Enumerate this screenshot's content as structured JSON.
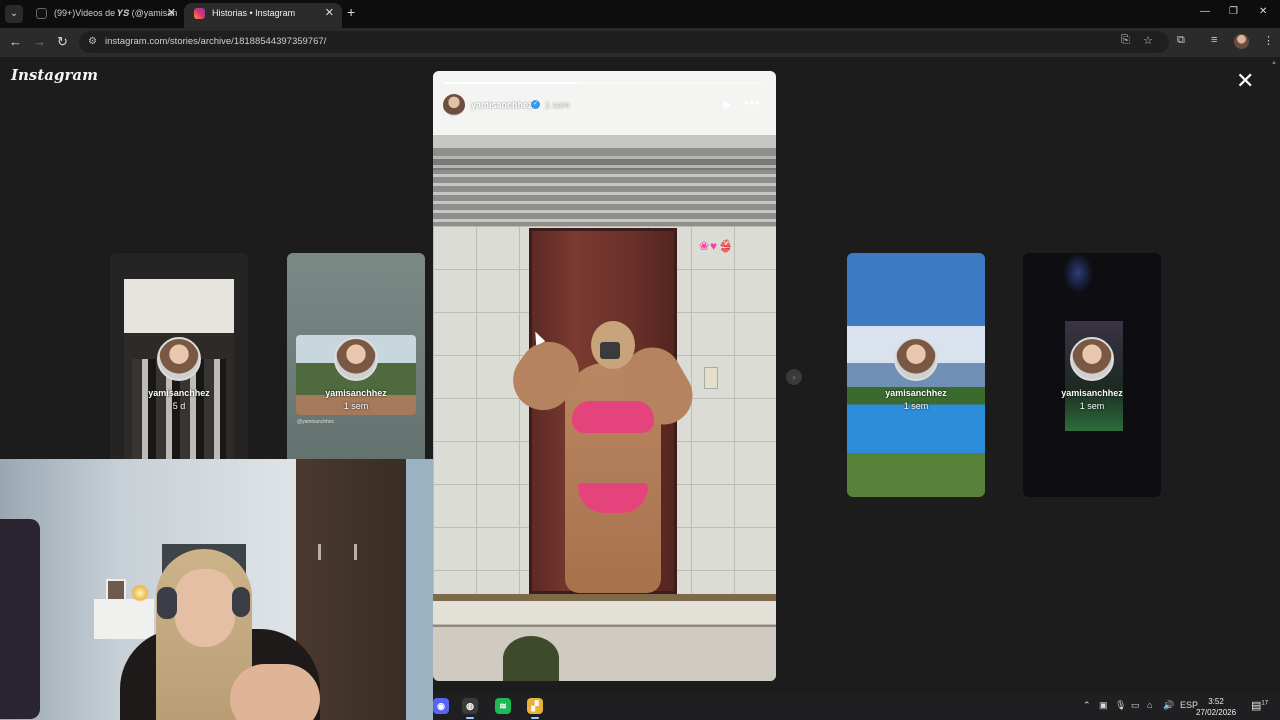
{
  "browser": {
    "tabs": [
      {
        "title": "(99+)Videos de 𝒀𝑺 (@yamisan",
        "close": "✕"
      },
      {
        "title": "Historias • Instagram",
        "close": "✕"
      }
    ],
    "new_tab": "+",
    "tab_search": "⌄",
    "window_controls": {
      "minimize": "—",
      "restore": "❐",
      "close": "✕"
    },
    "nav": {
      "back": "←",
      "forward": "→",
      "reload": "↻"
    },
    "url": "instagram.com/stories/archive/18188544397359767/",
    "icons": [
      "install-app-icon",
      "bookmark-star-icon",
      "extensions-icon",
      "media-controls-icon",
      "profile-avatar",
      "menu-kebab-icon"
    ]
  },
  "instagram": {
    "logo": "Instagram",
    "close": "✕",
    "main_story": {
      "username": "yamisanchhez",
      "verified": "✓",
      "time_ago": "1 sem",
      "progress": 0.42,
      "play": "▶",
      "more": "•••",
      "stickers": "❀♥👙"
    },
    "side_stories": [
      {
        "username": "yamisanchhez",
        "time_ago": "5 d"
      },
      {
        "username": "yamisanchhez",
        "time_ago": "1 sem",
        "caption": "@yamisanchhez"
      },
      {
        "username": "yamisanchhez",
        "time_ago": "1 sem"
      },
      {
        "username": "yamisanchhez",
        "time_ago": "1 sem"
      }
    ],
    "next_arrow": "›"
  },
  "taskbar": {
    "apps": [
      {
        "name": "discord-icon",
        "glyph": "◉",
        "color": "#5865f2"
      },
      {
        "name": "obs-icon",
        "glyph": "◍",
        "color": "#3a3a3a"
      },
      {
        "name": "spotify-icon",
        "glyph": "≋",
        "color": "#1db954"
      },
      {
        "name": "file-icon",
        "glyph": "▞",
        "color": "#e7b23a"
      }
    ],
    "tray": {
      "chevron": "⌃",
      "language": "ESP"
    },
    "time": "3:52",
    "date": "27/02/2026",
    "notifications": "17"
  }
}
